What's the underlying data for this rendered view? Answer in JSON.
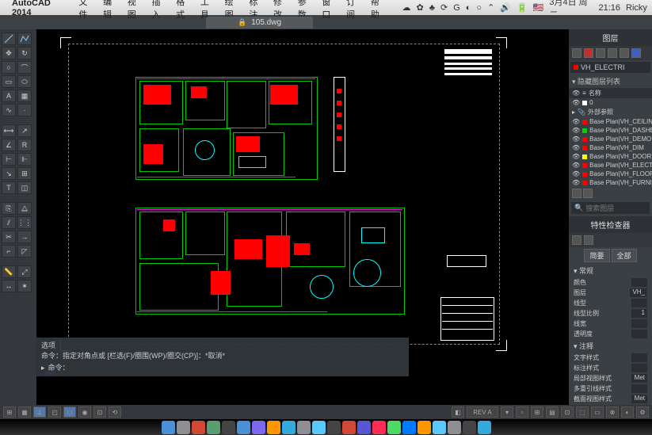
{
  "menubar": {
    "apple": "",
    "app_name": "AutoCAD 2014",
    "items": [
      "文件",
      "编辑",
      "视图",
      "插入",
      "格式",
      "工具",
      "绘图",
      "标注",
      "修改",
      "参数",
      "窗口",
      "订阅",
      "帮助"
    ],
    "flag": "🇺🇸",
    "date": "3月4日 周二",
    "time": "21:16",
    "user": "Ricky"
  },
  "tab": {
    "filename": "105.dwg"
  },
  "layers_panel": {
    "title": "图层",
    "current": "VH_ELECTRI",
    "hidden_hdr": "隐藏图层列表",
    "name_col": "名称",
    "zero": "0",
    "xref": "外部参照",
    "items": [
      {
        "color": "#ff0000",
        "label": "Base Plan|VH_CEILING"
      },
      {
        "color": "#00d000",
        "label": "Base Plan|VH_DASHED"
      },
      {
        "color": "#ff0000",
        "label": "Base Plan|VH_DEMO..."
      },
      {
        "color": "#ff0000",
        "label": "Base Plan|VH_DIM"
      },
      {
        "color": "#ffff00",
        "label": "Base Plan|VH_DOORS"
      },
      {
        "color": "#ff0000",
        "label": "Base Plan|VH_ELECT..."
      },
      {
        "color": "#ff0000",
        "label": "Base Plan|VH_FLOOR"
      },
      {
        "color": "#ff0000",
        "label": "Base Plan|VH_FURNI..."
      }
    ],
    "search_placeholder": "搜索图层"
  },
  "props_panel": {
    "title": "特性检查器",
    "btn_common": "简要",
    "btn_all": "全部",
    "group_common": "常规",
    "rows_common": [
      {
        "label": "颜色",
        "val": ""
      },
      {
        "label": "图层",
        "val": "VH_"
      },
      {
        "label": "线型",
        "val": ""
      },
      {
        "label": "线型比例",
        "val": "1"
      },
      {
        "label": "线宽",
        "val": ""
      },
      {
        "label": "透明度",
        "val": ""
      }
    ],
    "group_annot": "注释",
    "rows_annot": [
      {
        "label": "文字样式",
        "val": ""
      },
      {
        "label": "标注样式",
        "val": ""
      },
      {
        "label": "局部视图样式",
        "val": "Met"
      },
      {
        "label": "多重引线样式",
        "val": ""
      },
      {
        "label": "截面视图样式",
        "val": "Met"
      }
    ]
  },
  "command": {
    "line1": "选项",
    "line2": "命令：指定对角点或 [栏选(F)/圈围(WP)/圈交(CP)]：*取消*",
    "prompt": "命令："
  },
  "status": {
    "rev": "REV A"
  },
  "dock_colors": [
    "#4a90d9",
    "#8e8e93",
    "#d14836",
    "#5a9e6f",
    "#444",
    "#4a90d9",
    "#7b68ee",
    "#ff9500",
    "#34aadc",
    "#8e8e93",
    "#5ac8fa",
    "#444",
    "#d14836",
    "#5856d6",
    "#ff2d55",
    "#4cd964",
    "#007aff",
    "#ff9500",
    "#5ac8fa",
    "#8e8e93",
    "#444",
    "#34aadc"
  ]
}
